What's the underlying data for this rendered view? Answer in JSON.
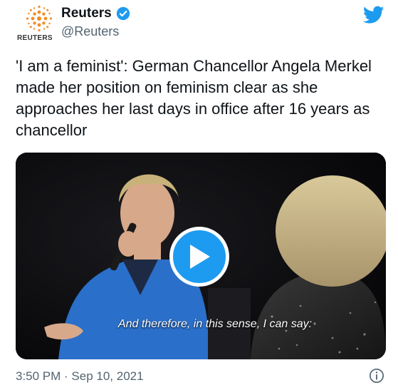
{
  "author": {
    "display_name": "Reuters",
    "handle": "@Reuters",
    "avatar_label": "REUTERS",
    "verified": true
  },
  "tweet": {
    "text": "'I am a feminist': German Chancellor Angela Merkel made her position on feminism clear as she approaches her last days in office after 16 years as chancellor"
  },
  "media": {
    "type": "video",
    "caption": "And therefore, in this sense, I can say:",
    "play_icon": "play-icon"
  },
  "footer": {
    "timestamp": "3:50 PM · Sep 10, 2021",
    "info_icon": "info-icon"
  },
  "colors": {
    "accent": "#1d9bf0",
    "text": "#0f1419",
    "secondary_text": "#536471",
    "blazer": "#2a6fc9"
  }
}
